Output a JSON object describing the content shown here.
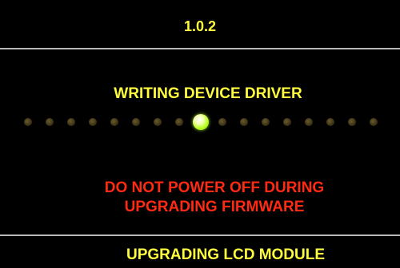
{
  "header": {
    "version": "1.0.2"
  },
  "progress": {
    "step_label": "WRITING DEVICE DRIVER",
    "active_dot": 8,
    "dot_count": 17
  },
  "warning": {
    "line1": "DO NOT POWER OFF DURING",
    "line2": "UPGRADING FIRMWARE"
  },
  "status": {
    "label": "UPGRADING LCD MODULE"
  },
  "colors": {
    "background": "#000000",
    "label_yellow": "#ffff3c",
    "warning_red": "#ff2a12",
    "active_dot": "#b7ff1f",
    "inactive_dot": "#3b3216",
    "divider": "#b8b8b8"
  }
}
